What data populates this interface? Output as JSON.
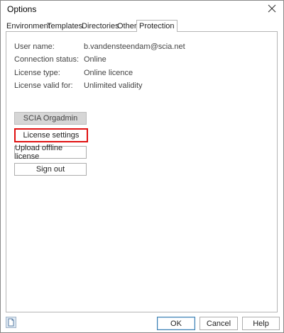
{
  "window": {
    "title": "Options",
    "close_icon": "close-icon"
  },
  "tabs": [
    {
      "label": "Environment",
      "active": false
    },
    {
      "label": "Templates",
      "active": false
    },
    {
      "label": "Directories",
      "active": false
    },
    {
      "label": "Other",
      "active": false
    },
    {
      "label": "Protection",
      "active": true
    }
  ],
  "protection": {
    "rows": [
      {
        "label": "User name:",
        "value": "b.vandensteendam@scia.net"
      },
      {
        "label": "Connection status:",
        "value": "Online"
      },
      {
        "label": "License type:",
        "value": "Online licence"
      },
      {
        "label": "License valid for:",
        "value": "Unlimited validity"
      }
    ],
    "buttons": {
      "orgadmin": "SCIA Orgadmin",
      "license_settings": "License settings",
      "upload_offline": "Upload offline license",
      "sign_out": "Sign out"
    }
  },
  "footer": {
    "icon": "document-icon",
    "ok": "OK",
    "cancel": "Cancel",
    "help": "Help"
  },
  "colors": {
    "highlight_border": "#e01010",
    "disabled_button": "#d6d6d6",
    "default_button_border": "#3c7fb1"
  }
}
